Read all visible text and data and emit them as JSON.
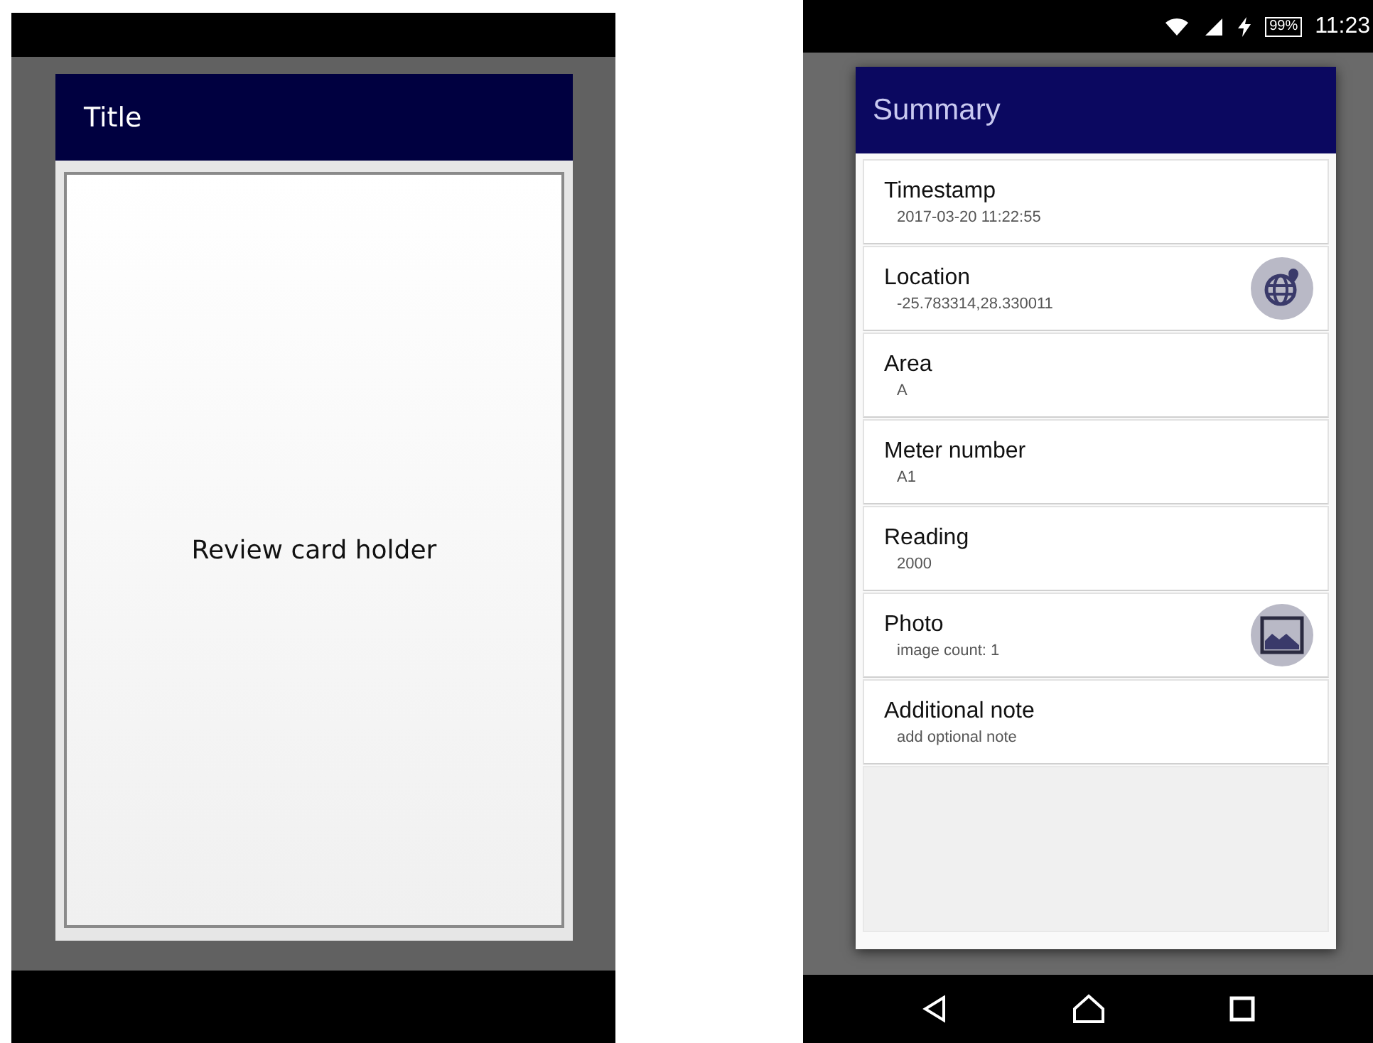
{
  "mockup": {
    "dialog": {
      "title": "Title"
    },
    "card": {
      "label": "Review card holder"
    }
  },
  "phone": {
    "status_bar": {
      "battery": "99%",
      "time": "11:23"
    },
    "dialog": {
      "title": "Summary",
      "rows": [
        {
          "label": "Timestamp",
          "value": "2017-03-20 11:22:55",
          "kind": "text"
        },
        {
          "label": "Location",
          "value": "-25.783314,28.330011",
          "kind": "globe"
        },
        {
          "label": "Area",
          "value": "A",
          "kind": "text"
        },
        {
          "label": "Meter number",
          "value": "A1",
          "kind": "text"
        },
        {
          "label": "Reading",
          "value": "2000",
          "kind": "text"
        },
        {
          "label": "Photo",
          "value": "image count: 1",
          "kind": "image"
        },
        {
          "label": "Additional note",
          "value": "add optional note",
          "kind": "text"
        }
      ]
    }
  }
}
